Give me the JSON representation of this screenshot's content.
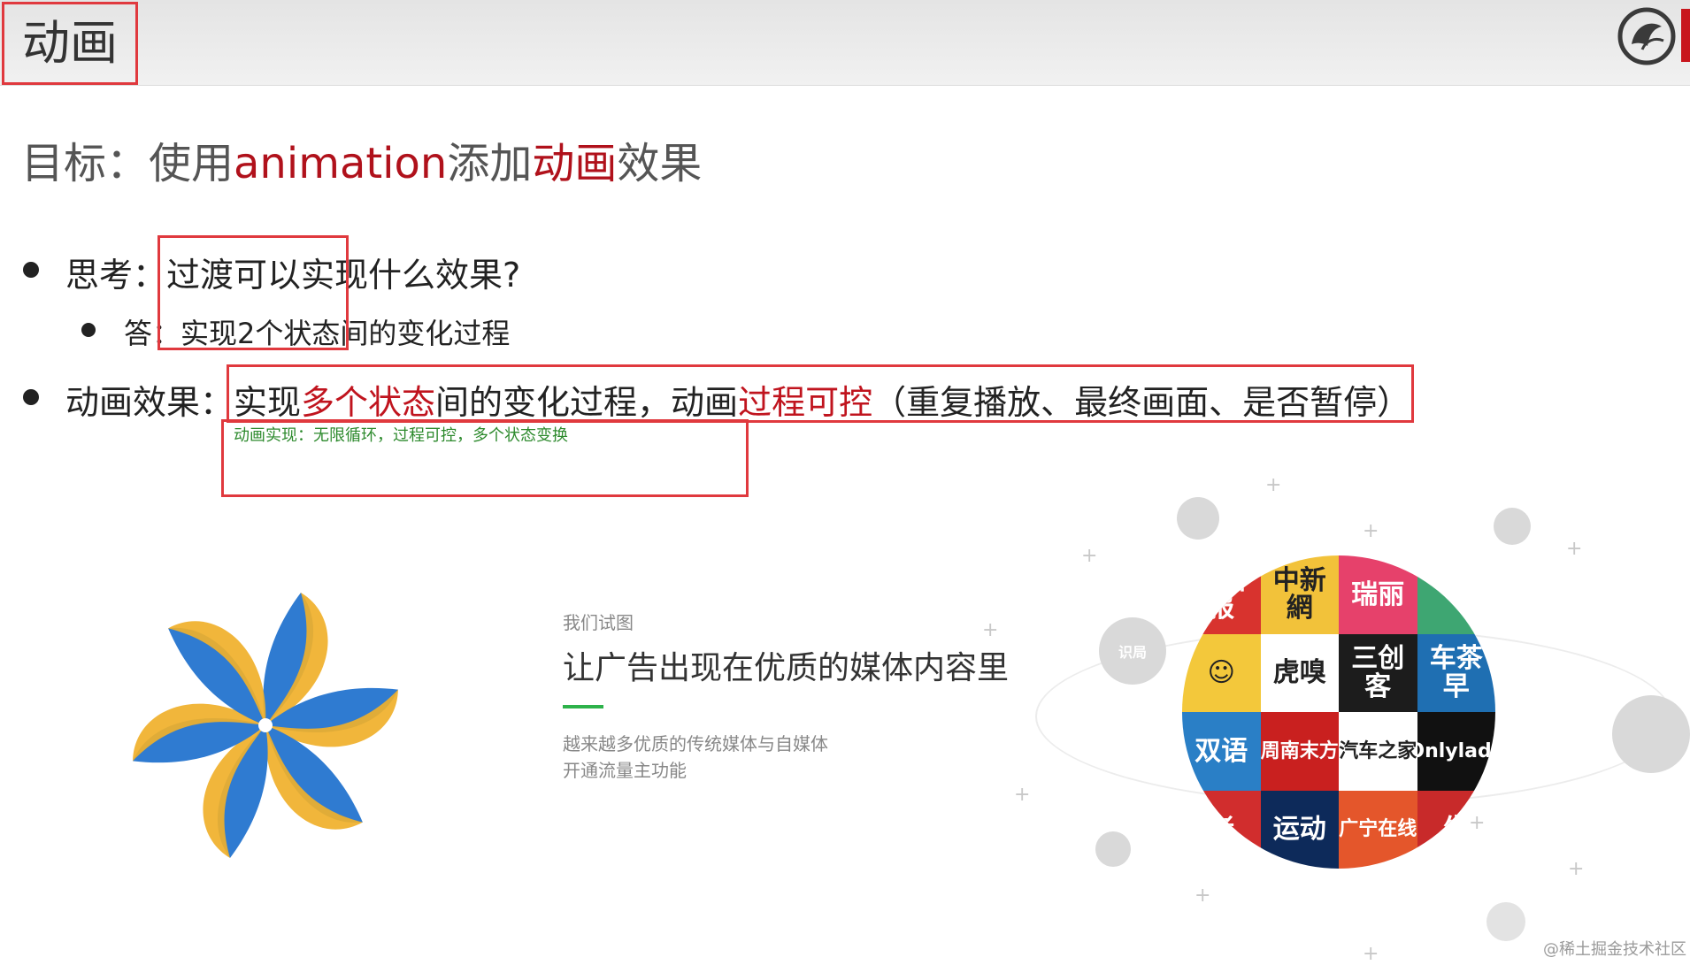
{
  "header": {
    "title": "动画"
  },
  "goal": {
    "prefix": "目标：使用",
    "keyword": "animation",
    "middle": "添加",
    "highlight": "动画",
    "suffix": "效果"
  },
  "bullets": {
    "q": "思考：过渡可以实现什么效果?",
    "a_label": "答",
    "a_text": "：实现2个状态间的变化过程",
    "effect": {
      "label": "动画效果：",
      "t1": "实现",
      "t2": "多个状态",
      "t3": "间的变化过程，动画",
      "t4": "过程可控",
      "t5": "（重复播放、最终画面、是否暂停）"
    }
  },
  "note": "动画实现：无限循环，过程可控，多个状态变换",
  "promo": {
    "small": "我们试图",
    "title": "让广告出现在优质的媒体内容里",
    "desc1": "越来越多优质的传统媒体与自媒体",
    "desc2": "开通流量主功能"
  },
  "media_tiles": [
    {
      "text": "川日报",
      "color": "#d8332e"
    },
    {
      "text": "中新網",
      "color": "#f2c23a"
    },
    {
      "text": "瑞丽",
      "color": "#e6416b"
    },
    {
      "text": "",
      "color": "#3ea672"
    },
    {
      "text": "☺",
      "color": "#f3c83b"
    },
    {
      "text": "虎嗅",
      "color": "#ffffff"
    },
    {
      "text": "三创客",
      "color": "#1c1c1c"
    },
    {
      "text": "车茶早",
      "color": "#1f6fb2"
    },
    {
      "text": "双语",
      "color": "#2a7fc6"
    },
    {
      "text": "周南末方",
      "color": "#c9201f"
    },
    {
      "text": "汽车之家",
      "color": "#ffffff"
    },
    {
      "text": "Onlylady",
      "color": "#111111"
    },
    {
      "text": "者",
      "color": "#d12d2d"
    },
    {
      "text": "运动",
      "color": "#0d2a5a"
    },
    {
      "text": "广宁在线",
      "color": "#e4562b"
    },
    {
      "text": "生",
      "color": "#c82a2a"
    }
  ],
  "side_badges": [
    "识局"
  ],
  "watermark": "@稀土掘金技术社区"
}
